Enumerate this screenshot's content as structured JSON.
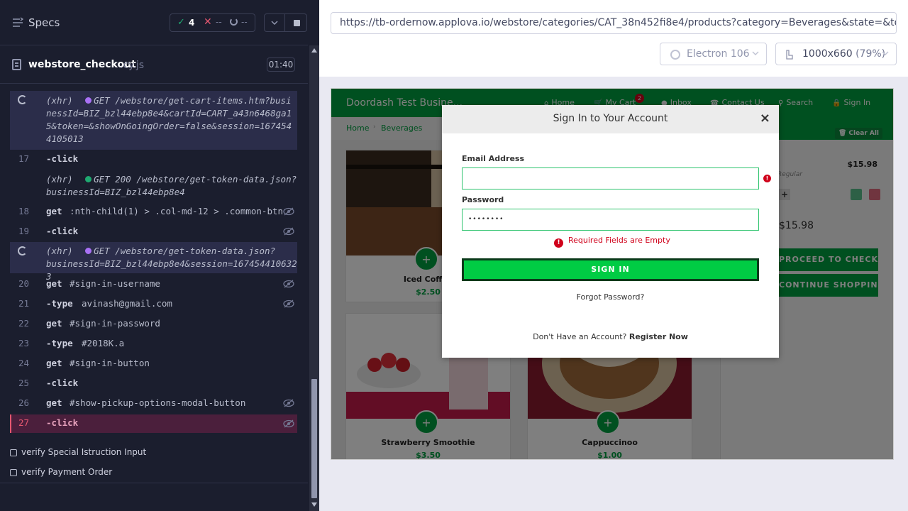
{
  "reporter": {
    "specs_title": "Specs",
    "stats": {
      "passed": "4",
      "failed": "--",
      "pending": "--"
    },
    "file": {
      "name": "webstore_checkout",
      "ext": ".cy.js",
      "duration": "01:40"
    },
    "log": [
      {
        "type": "xhr",
        "text": "(xhr)  GET /webstore/get-cart-items.htm?businessId=BIZ_bzl44ebp8e4&cartId=CART_a43n6468ga15&token=&showOnGoingOrder=false&session=1674544105013"
      },
      {
        "num": "17",
        "cmd": "-click",
        "msg": ""
      },
      {
        "type": "xhr2",
        "line1": "(xhr)  GET 200 /webstore/get-token-data.json?",
        "line2": "businessId=BIZ_bzl44ebp8e4"
      },
      {
        "num": "18",
        "cmd": "get",
        "msg": ":nth-child(1) > .col-md-12 > .common-btn"
      },
      {
        "num": "19",
        "cmd": "-click",
        "msg": ""
      },
      {
        "type": "xhr3",
        "line1": "(xhr)  GET /webstore/get-token-data.json?",
        "line2": "businessId=BIZ_bzl44ebp8e4&session=1674544106323"
      },
      {
        "num": "20",
        "cmd": "get",
        "msg": "#sign-in-username"
      },
      {
        "num": "21",
        "cmd": "-type",
        "msg": "avinash@gmail.com"
      },
      {
        "num": "22",
        "cmd": "get",
        "msg": "#sign-in-password"
      },
      {
        "num": "23",
        "cmd": "-type",
        "msg": "#2018K.a"
      },
      {
        "num": "24",
        "cmd": "get",
        "msg": "#sign-in-button"
      },
      {
        "num": "25",
        "cmd": "-click",
        "msg": ""
      },
      {
        "num": "26",
        "cmd": "get",
        "msg": "#show-pickup-options-modal-button"
      },
      {
        "num": "27",
        "cmd": "-click",
        "msg": ""
      }
    ],
    "tests": [
      "verify Special Istruction Input",
      "verify Payment Order"
    ]
  },
  "aut": {
    "url": "https://tb-ordernow.applova.io/webstore/categories/CAT_38n452fi8e4/products?category=Beverages&state=&token=&ca",
    "browser": "Electron 106",
    "viewport": "1000x660",
    "viewport_pct": "(79%)"
  },
  "app": {
    "brand": "Doordash Test Busine...",
    "nav": {
      "home": "Home",
      "cart": "My Cart",
      "cart_count": "2",
      "inbox": "Inbox",
      "contact": "Contact Us",
      "search": "Search",
      "signin": "Sign In"
    },
    "breadcrumb": {
      "home": "Home",
      "category": "Beverages"
    },
    "products": [
      {
        "name": "Iced Coffee",
        "price": "$2.50"
      },
      {
        "name": "Strawberry Smoothie",
        "price": "$3.50"
      },
      {
        "name": "Cappuccinoo",
        "price": "$1.00"
      }
    ],
    "cart": {
      "clear_all": "Clear All",
      "item_price": "$15.98",
      "item_modifier": "Regular",
      "total": "$15.98",
      "checkout": "PROCEED TO CHECKOUT",
      "continue": "CONTINUE SHOPPING"
    }
  },
  "modal": {
    "title": "Sign In to Your Account",
    "close": "×",
    "email_label": "Email Address",
    "email_value": "",
    "password_label": "Password",
    "password_value": "••••••••",
    "error": "Required Fields are Empty",
    "signin_button": "SIGN IN",
    "forgot": "Forgot Password?",
    "no_account": "Don't Have an Account?",
    "register": "Register Now"
  }
}
